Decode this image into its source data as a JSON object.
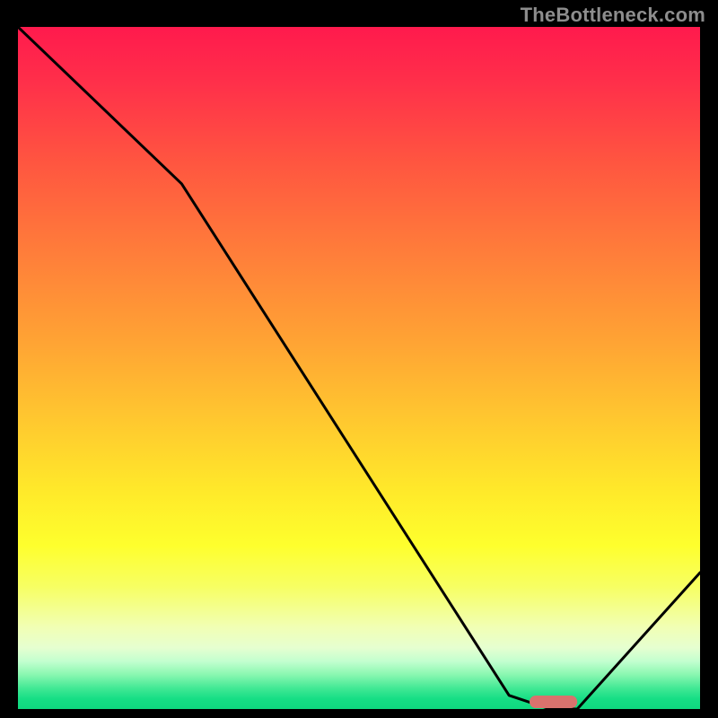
{
  "watermark": "TheBottleneck.com",
  "chart_data": {
    "type": "line",
    "title": "",
    "xlabel": "",
    "ylabel": "",
    "xlim": [
      0,
      100
    ],
    "ylim": [
      0,
      100
    ],
    "grid": false,
    "series": [
      {
        "name": "bottleneck-curve",
        "x": [
          0,
          24,
          72,
          78,
          82,
          100
        ],
        "values": [
          100,
          77,
          2,
          0,
          0,
          20
        ]
      }
    ],
    "marker": {
      "x_start": 75,
      "x_end": 82,
      "y": 0
    },
    "background_gradient": {
      "type": "vertical",
      "stops": [
        {
          "pos": 0.0,
          "color": "#ff1a4d"
        },
        {
          "pos": 0.2,
          "color": "#ff5640"
        },
        {
          "pos": 0.46,
          "color": "#ffa334"
        },
        {
          "pos": 0.68,
          "color": "#ffe92a"
        },
        {
          "pos": 0.88,
          "color": "#f1ffb4"
        },
        {
          "pos": 0.97,
          "color": "#40e894"
        },
        {
          "pos": 1.0,
          "color": "#0fd87f"
        }
      ]
    }
  }
}
